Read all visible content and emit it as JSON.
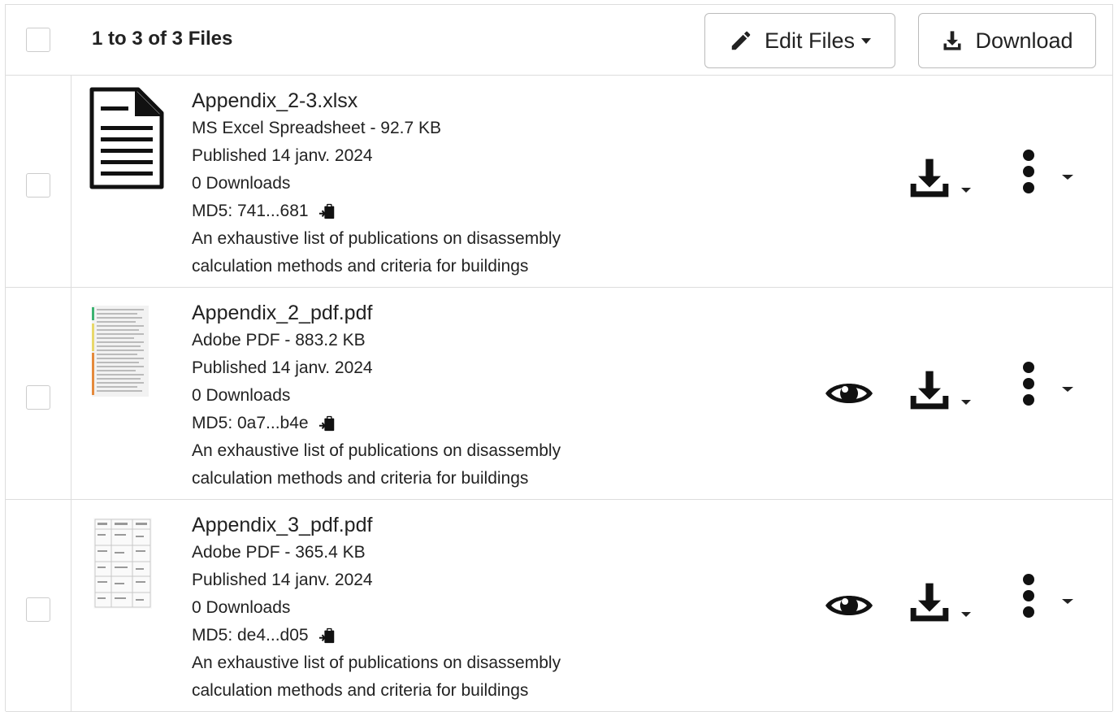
{
  "header": {
    "count_text": "1 to 3 of 3 Files",
    "edit_label": "Edit Files",
    "download_label": "Download"
  },
  "files": [
    {
      "name": "Appendix_2-3.xlsx",
      "type_size": "MS Excel Spreadsheet - 92.7 KB",
      "published": "Published 14 janv. 2024",
      "downloads": "0 Downloads",
      "md5": "MD5: 741...681",
      "desc1": "An exhaustive list of publications on disassembly",
      "desc2": "calculation methods and criteria for buildings",
      "thumbnail": "document-icon"
    },
    {
      "name": "Appendix_2_pdf.pdf",
      "type_size": "Adobe PDF - 883.2 KB",
      "published": "Published 14 janv. 2024",
      "downloads": "0 Downloads",
      "md5": "MD5: 0a7...b4e",
      "desc1": "An exhaustive list of publications on disassembly",
      "desc2": "calculation methods and criteria for buildings",
      "thumbnail": "pdf-page-thumbnail"
    },
    {
      "name": "Appendix_3_pdf.pdf",
      "type_size": "Adobe PDF - 365.4 KB",
      "published": "Published 14 janv. 2024",
      "downloads": "0 Downloads",
      "md5": "MD5: de4...d05",
      "desc1": "An exhaustive list of publications on disassembly",
      "desc2": "calculation methods and criteria for buildings",
      "thumbnail": "pdf-table-thumbnail"
    }
  ],
  "icons": {
    "edit": "pencil-icon",
    "download": "download-icon",
    "preview": "eye-icon",
    "more": "ellipsis-vertical-icon",
    "copy": "clipboard-icon"
  }
}
